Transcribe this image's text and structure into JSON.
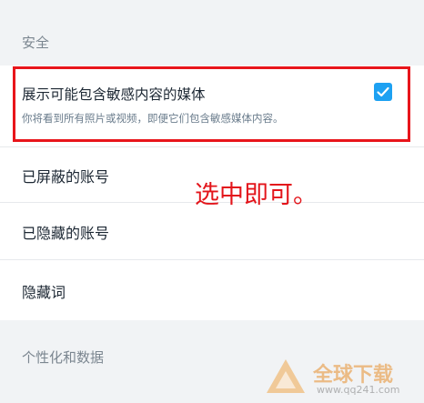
{
  "sections": {
    "security_title": "安全",
    "personalization_title": "个性化和数据"
  },
  "settings": {
    "sensitive_media": {
      "label": "展示可能包含敏感内容的媒体",
      "description": "你将看到所有照片或视频，即便它们包含敏感媒体内容。",
      "checked": true
    },
    "blocked_accounts": "已屏蔽的账号",
    "muted_accounts": "已隐藏的账号",
    "muted_words": "隐藏词"
  },
  "annotation": "选中即可。",
  "watermark": {
    "title": "全球下载",
    "url": "www.qq241.com"
  },
  "colors": {
    "accent": "#1da1f2",
    "highlight": "#e8151b",
    "section_bg": "#f1f3f5"
  }
}
